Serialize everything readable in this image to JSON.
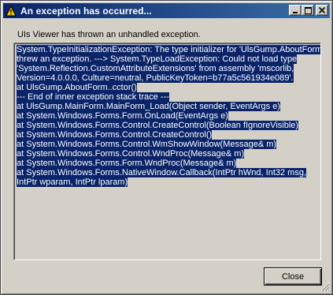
{
  "window": {
    "title": "An exception has occurred...",
    "title_icon": "warning-icon",
    "controls": [
      "minimize-icon",
      "maximize-icon",
      "close-icon"
    ]
  },
  "message": "UIs Viewer has thrown an unhandled exception.",
  "exception_lines": [
    "System.TypeInitializationException: The type initializer for 'UlsGump.AboutForm'",
    "threw an exception. ---> System.TypeLoadException: Could not load type",
    "'System.Reflection.CustomAttributeExtensions' from assembly 'mscorlib,",
    "Version=4.0.0.0, Culture=neutral, PublicKeyToken=b77a5c561934e089'.",
    "   at UlsGump.AboutForm..cctor()",
    "   --- End of inner exception stack trace ---",
    "   at UlsGump.MainForm.MainForm_Load(Object sender, EventArgs e)",
    "   at System.Windows.Forms.Form.OnLoad(EventArgs e)",
    "   at System.Windows.Forms.Control.CreateControl(Boolean fIgnoreVisible)",
    "   at System.Windows.Forms.Control.CreateControl()",
    "   at System.Windows.Forms.Control.WmShowWindow(Message& m)",
    "   at System.Windows.Forms.Control.WndProc(Message& m)",
    "   at System.Windows.Forms.Form.WndProc(Message& m)",
    "   at System.Windows.Forms.NativeWindow.Callback(IntPtr hWnd, Int32 msg,",
    "IntPtr wparam, IntPtr lparam)"
  ],
  "buttons": {
    "close_label": "Close"
  },
  "colors": {
    "titlebar_start": "#0a246a",
    "titlebar_end": "#3a6ea5",
    "selection": "#0a246a",
    "face": "#d4d0c8"
  }
}
